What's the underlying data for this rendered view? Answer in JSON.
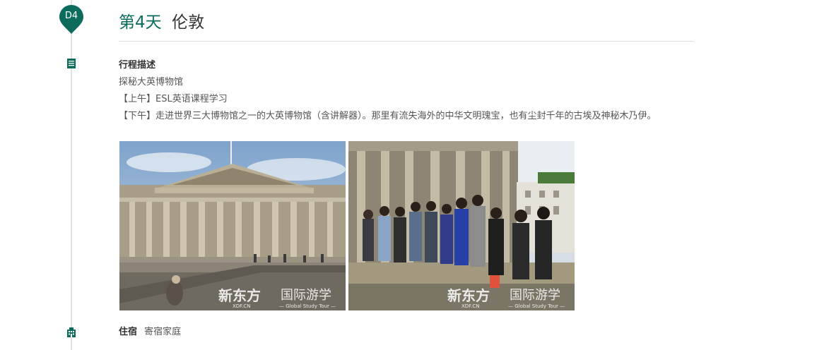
{
  "day": {
    "marker": "D4",
    "number_label": "第4天",
    "city": "伦敦"
  },
  "itinerary": {
    "heading": "行程描述",
    "subtitle": "探秘大英博物馆",
    "morning": "【上午】ESL英语课程学习",
    "afternoon": "【下午】走进世界三大博物馆之一的大英博物馆（含讲解器）。那里有流失海外的中华文明瑰宝，也有尘封千年的古埃及神秘木乃伊。"
  },
  "photos": [
    {
      "subject": "British Museum facade",
      "watermark_brand": "新东方",
      "watermark_sub": "XDF.CN",
      "watermark_title": "国际游学",
      "watermark_tagline": "— Global Study Tour —"
    },
    {
      "subject": "Students seated by museum columns",
      "watermark_brand": "新东方",
      "watermark_sub": "XDF.CN",
      "watermark_title": "国际游学",
      "watermark_tagline": "— Global Study Tour —"
    }
  ],
  "accommodation": {
    "label": "住宿",
    "value": "寄宿家庭"
  },
  "colors": {
    "accent": "#0d6b5e",
    "timeline": "#e3e3e3",
    "divider": "#dedede",
    "heading_text": "#333333",
    "body_text": "#555555"
  },
  "icons": {
    "itinerary": "document-list-icon",
    "accommodation": "building-icon"
  }
}
